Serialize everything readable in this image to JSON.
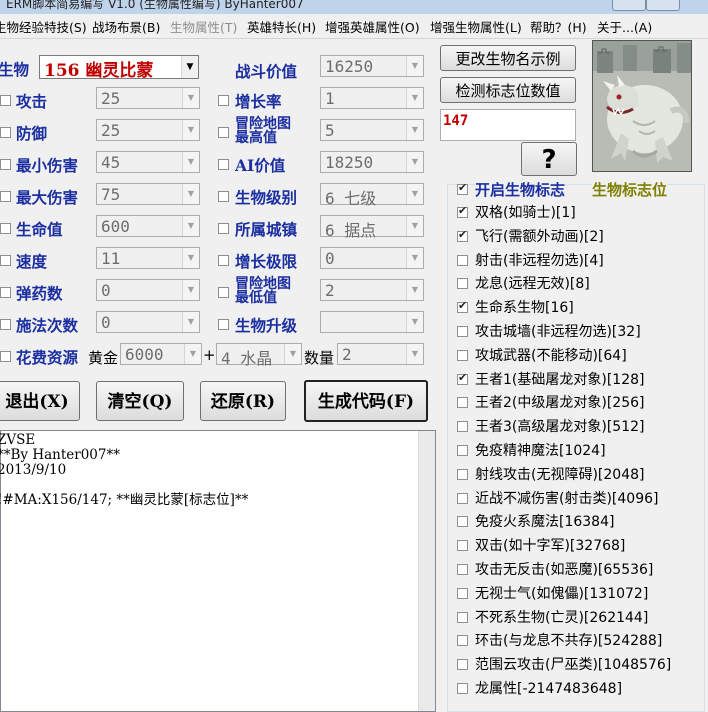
{
  "window": {
    "title": "ERM脚本简易编写 V1.0 (生物属性编写) ByHanter007"
  },
  "menu": [
    {
      "label": "生物经验特技(S)",
      "disabled": false
    },
    {
      "label": "战场布景(B)",
      "disabled": false
    },
    {
      "label": "生物属性(T)",
      "disabled": true
    },
    {
      "label": "英雄特长(H)",
      "disabled": false
    },
    {
      "label": "增强英雄属性(O)",
      "disabled": false
    },
    {
      "label": "增强生物属性(L)",
      "disabled": false
    },
    {
      "label": "帮助？(H)",
      "disabled": false
    },
    {
      "label": "关于...(A)",
      "disabled": false
    }
  ],
  "creature": {
    "label": "生物",
    "value": "156  幽灵比蒙"
  },
  "left_fields": [
    {
      "label": "攻击",
      "value": "25"
    },
    {
      "label": "防御",
      "value": "25"
    },
    {
      "label": "最小伤害",
      "value": "45"
    },
    {
      "label": "最大伤害",
      "value": "75"
    },
    {
      "label": "生命值",
      "value": "600"
    },
    {
      "label": "速度",
      "value": "11"
    },
    {
      "label": "弹药数",
      "value": "0"
    },
    {
      "label": "施法次数",
      "value": "0"
    }
  ],
  "right_fields": [
    {
      "label": "战斗价值",
      "value": "16250",
      "checkbox": false
    },
    {
      "label": "增长率",
      "value": "1",
      "checkbox": true
    },
    {
      "label": "冒险地图最高值",
      "line1": "冒险地图",
      "line2": "最高值",
      "value": "5",
      "checkbox": true
    },
    {
      "label": "AI价值",
      "value": "18250",
      "checkbox": true
    },
    {
      "label": "生物级别",
      "value": "6  七级",
      "checkbox": true
    },
    {
      "label": "所属城镇",
      "value": "6  据点",
      "checkbox": true
    },
    {
      "label": "增长极限",
      "value": "0",
      "checkbox": true
    },
    {
      "label": "冒险地图最低值",
      "line1": "冒险地图",
      "line2": "最低值",
      "value": "2",
      "checkbox": true
    },
    {
      "label": "生物升级",
      "value": "",
      "checkbox": true
    }
  ],
  "cost": {
    "label": "花费资源",
    "gold_label": "黄金",
    "gold_value": "6000",
    "plus": "+",
    "resource_value": "4  水晶",
    "qty_label": "数量",
    "qty_value": "2"
  },
  "buttons": {
    "rename": "更改生物名示例",
    "detect": "检测标志位数值",
    "question": "?",
    "exit": "退出(X)",
    "clear": "清空(Q)",
    "restore": "还原(R)",
    "generate": "生成代码(F)"
  },
  "flag_value": "147",
  "code_text": "ZVSE\n**By Hanter007**\n2013/9/10\n\n!#MA:X156/147; **幽灵比蒙[标志位]**",
  "flags_group": {
    "title": "开启生物标志",
    "subtitle": "生物标志位",
    "title_checked": true,
    "items": [
      {
        "label": "双格(如骑士)[1]",
        "checked": true
      },
      {
        "label": "飞行(需额外动画)[2]",
        "checked": true
      },
      {
        "label": "射击(非远程勿选)[4]",
        "checked": false
      },
      {
        "label": "龙息(远程无效)[8]",
        "checked": false
      },
      {
        "label": "生命系生物[16]",
        "checked": true
      },
      {
        "label": "攻击城墙(非远程勿选)[32]",
        "checked": false
      },
      {
        "label": "攻城武器(不能移动)[64]",
        "checked": false
      },
      {
        "label": "王者1(基础屠龙对象)[128]",
        "checked": true
      },
      {
        "label": "王者2(中级屠龙对象)[256]",
        "checked": false
      },
      {
        "label": "王者3(高级屠龙对象)[512]",
        "checked": false
      },
      {
        "label": "免疫精神魔法[1024]",
        "checked": false
      },
      {
        "label": "射线攻击(无视障碍)[2048]",
        "checked": false
      },
      {
        "label": "近战不减伤害(射击类)[4096]",
        "checked": false
      },
      {
        "label": "免疫火系魔法[16384]",
        "checked": false
      },
      {
        "label": "双击(如十字军)[32768]",
        "checked": false
      },
      {
        "label": "攻击无反击(如恶魔)[65536]",
        "checked": false
      },
      {
        "label": "无视士气(如傀儡)[131072]",
        "checked": false
      },
      {
        "label": "不死系生物(亡灵)[262144]",
        "checked": false
      },
      {
        "label": "环击(与龙息不共存)[524288]",
        "checked": false
      },
      {
        "label": "范围云攻击(尸巫类)[1048576]",
        "checked": false
      },
      {
        "label": "龙属性[-2147483648]",
        "checked": false
      }
    ]
  },
  "icons": {
    "portrait": "behemoth-portrait-icon",
    "dropdown": "chevron-down-icon"
  },
  "colors": {
    "label_blue": "#1c2fa0",
    "creature_red": "#c00000",
    "flag_red": "#c00000",
    "group_title": "#1c2fa0",
    "group_subtitle": "#808000"
  }
}
